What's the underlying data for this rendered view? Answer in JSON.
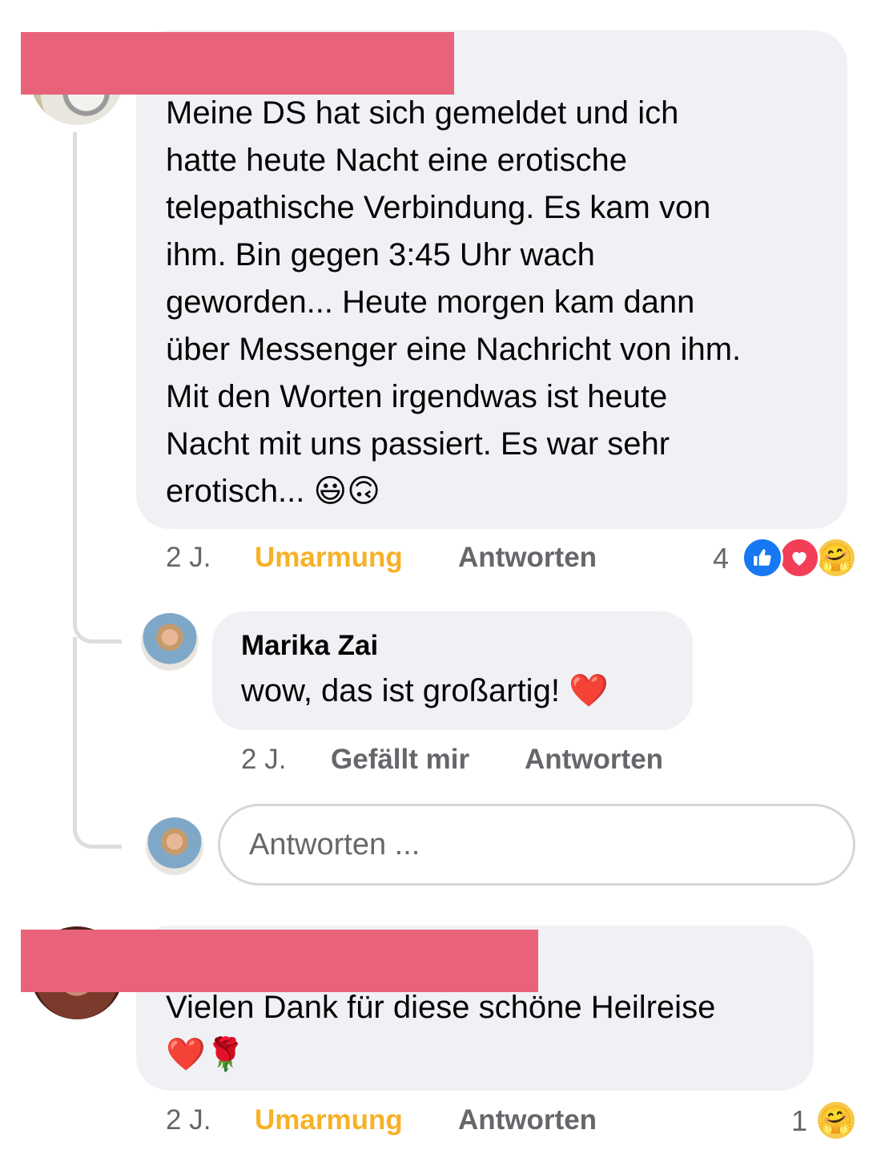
{
  "comments": [
    {
      "author_redacted": true,
      "text": "Meine DS hat sich gemeldet und ich\nhatte heute Nacht eine erotische\ntelepathische Verbindung. Es kam von\nihm. Bin gegen 3:45 Uhr wach\ngeworden... Heute morgen kam dann\nüber Messenger eine Nachricht von ihm.\nMit den Worten irgendwas ist heute\nNacht mit uns passiert. Es war sehr\nerotisch... 😃🙃",
      "time": "2 J.",
      "reaction_label": "Umarmung",
      "reply_label": "Antworten",
      "reaction_count": "4",
      "reaction_icons": [
        "like-icon",
        "love-icon",
        "care-icon"
      ],
      "replies": [
        {
          "author": "Marika Zai",
          "text": "wow, das ist großartig! ❤️",
          "time": "2 J.",
          "like_label": "Gefällt mir",
          "reply_label": "Antworten"
        }
      ],
      "reply_input": {
        "placeholder": "Antworten ..."
      }
    },
    {
      "author_redacted": true,
      "text": "Vielen Dank für diese schöne Heilreise\n❤️🌹",
      "time": "2 J.",
      "reaction_label": "Umarmung",
      "reply_label": "Antworten",
      "reaction_count": "1",
      "reaction_icons": [
        "care-icon"
      ]
    }
  ],
  "colors": {
    "bubble": "#f0f1f4",
    "meta_text": "#65676b",
    "hug_reaction": "#f7b125",
    "redaction": "#e8627a",
    "like": "#1877f2",
    "love": "#f33e58"
  }
}
